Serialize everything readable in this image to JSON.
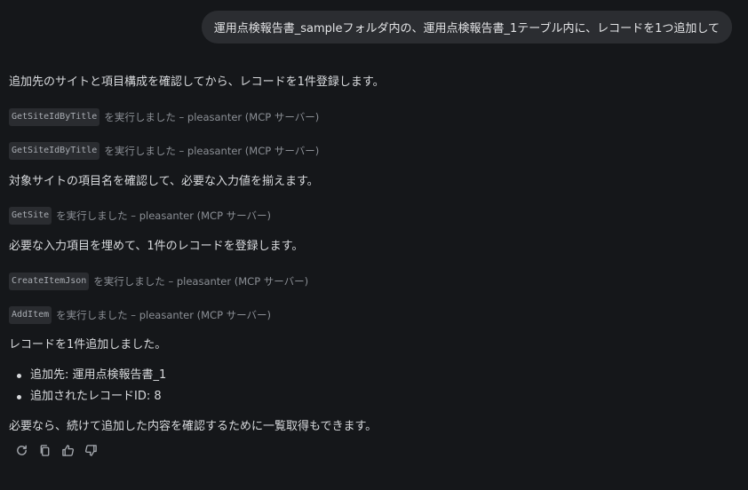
{
  "user_message": "運用点検報告書_sampleフォルダ内の、運用点検報告書_1テーブル内に、レコードを1つ追加して",
  "assistant": {
    "intro": "追加先のサイトと項目構成を確認してから、レコードを1件登録します。",
    "tool_calls_1": [
      {
        "name": "GetSiteIdByTitle",
        "suffix": "を実行しました – pleasanter (MCP サーバー)"
      },
      {
        "name": "GetSiteIdByTitle",
        "suffix": "を実行しました – pleasanter (MCP サーバー)"
      }
    ],
    "step2": "対象サイトの項目名を確認して、必要な入力値を揃えます。",
    "tool_calls_2": [
      {
        "name": "GetSite",
        "suffix": "を実行しました – pleasanter (MCP サーバー)"
      }
    ],
    "step3": "必要な入力項目を埋めて、1件のレコードを登録します。",
    "tool_calls_3": [
      {
        "name": "CreateItemJson",
        "suffix": "を実行しました – pleasanter (MCP サーバー)"
      },
      {
        "name": "AddItem",
        "suffix": "を実行しました – pleasanter (MCP サーバー)"
      }
    ],
    "result": "レコードを1件追加しました。",
    "bullets": [
      "追加先: 運用点検報告書_1",
      "追加されたレコードID: 8"
    ],
    "closing": "必要なら、続けて追加した内容を確認するために一覧取得もできます。"
  },
  "actions": [
    {
      "icon": "retry-icon"
    },
    {
      "icon": "copy-icon"
    },
    {
      "icon": "thumbs-up-icon"
    },
    {
      "icon": "thumbs-down-icon"
    }
  ]
}
